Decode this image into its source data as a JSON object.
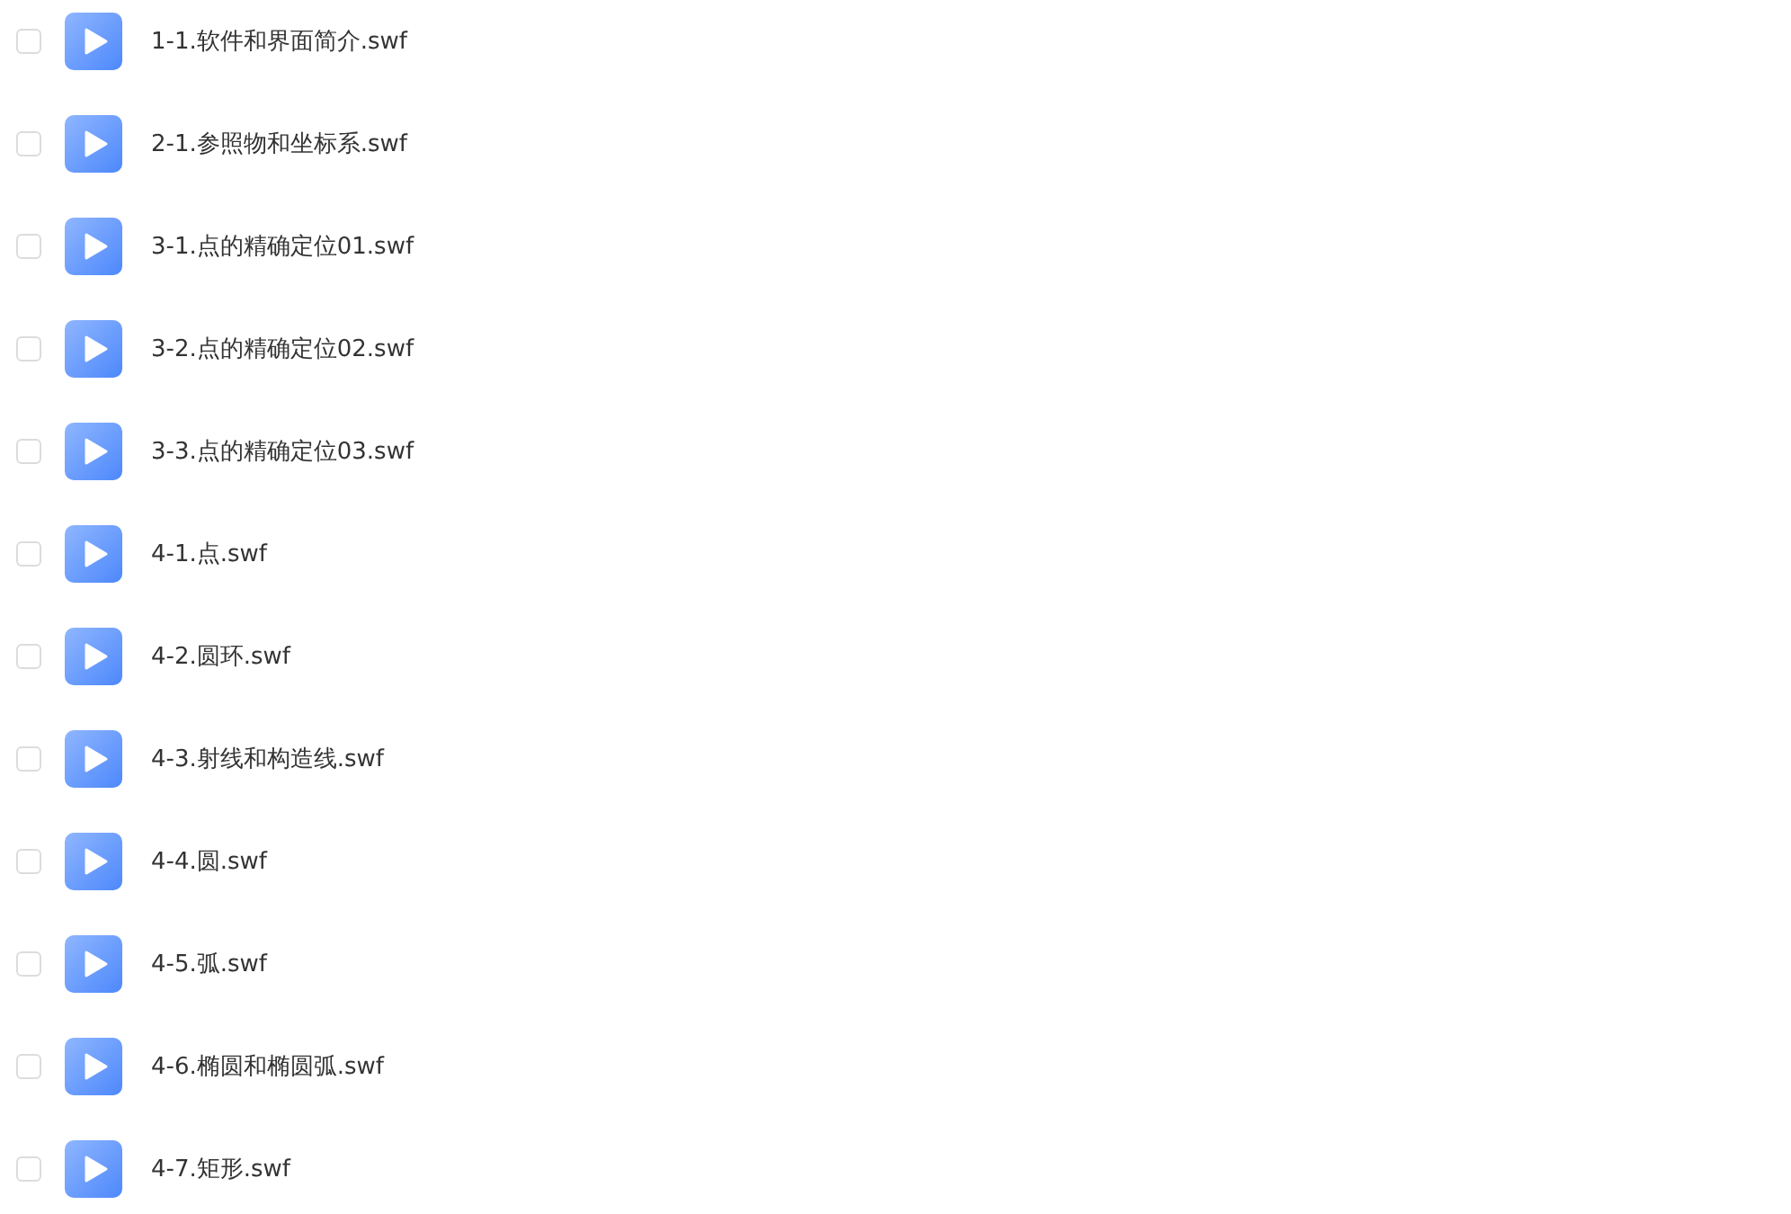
{
  "files": [
    {
      "name": "1-1.软件和界面简介.swf",
      "checked": false
    },
    {
      "name": "2-1.参照物和坐标系.swf",
      "checked": false
    },
    {
      "name": "3-1.点的精确定位01.swf",
      "checked": false
    },
    {
      "name": "3-2.点的精确定位02.swf",
      "checked": false
    },
    {
      "name": "3-3.点的精确定位03.swf",
      "checked": false
    },
    {
      "name": "4-1.点.swf",
      "checked": false
    },
    {
      "name": "4-2.圆环.swf",
      "checked": false
    },
    {
      "name": "4-3.射线和构造线.swf",
      "checked": false
    },
    {
      "name": "4-4.圆.swf",
      "checked": false
    },
    {
      "name": "4-5.弧.swf",
      "checked": false
    },
    {
      "name": "4-6.椭圆和椭圆弧.swf",
      "checked": false
    },
    {
      "name": "4-7.矩形.swf",
      "checked": false
    }
  ]
}
